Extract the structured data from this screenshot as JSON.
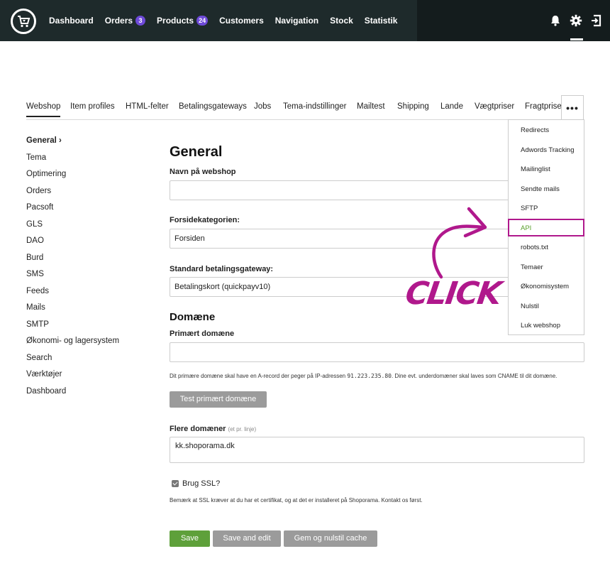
{
  "topnav": {
    "items": [
      {
        "label": "Dashboard"
      },
      {
        "label": "Orders",
        "badge": "3"
      },
      {
        "label": "Products",
        "badge": "24"
      },
      {
        "label": "Customers"
      },
      {
        "label": "Navigation"
      },
      {
        "label": "Stock"
      },
      {
        "label": "Statistik"
      }
    ],
    "icons": [
      "bell-icon",
      "gear-icon",
      "logout-icon"
    ]
  },
  "tabs": [
    {
      "label": "Webshop"
    },
    {
      "label": "Item profiles"
    },
    {
      "label": "HTML-felter"
    },
    {
      "label": "Betalingsgateways"
    },
    {
      "label": "Jobs"
    },
    {
      "label": "Tema-indstillinger"
    },
    {
      "label": "Mailtest"
    },
    {
      "label": "Shipping"
    },
    {
      "label": "Lande"
    },
    {
      "label": "Vægtpriser"
    },
    {
      "label": "Fragtpriser"
    }
  ],
  "more_label": "•••",
  "dropdown": [
    {
      "label": "Redirects"
    },
    {
      "label": "Adwords Tracking"
    },
    {
      "label": "Mailinglist"
    },
    {
      "label": "Sendte mails"
    },
    {
      "label": "SFTP"
    },
    {
      "label": "API"
    },
    {
      "label": "robots.txt"
    },
    {
      "label": "Temaer"
    },
    {
      "label": "Økonomisystem"
    },
    {
      "label": "Nulstil"
    },
    {
      "label": "Luk webshop"
    }
  ],
  "sidebar": [
    {
      "label": "General ›"
    },
    {
      "label": "Tema"
    },
    {
      "label": "Optimering"
    },
    {
      "label": "Orders"
    },
    {
      "label": "Pacsoft"
    },
    {
      "label": "GLS"
    },
    {
      "label": "DAO"
    },
    {
      "label": "Burd"
    },
    {
      "label": "SMS"
    },
    {
      "label": "Feeds"
    },
    {
      "label": "Mails"
    },
    {
      "label": "SMTP"
    },
    {
      "label": "Økonomi- og lagersystem"
    },
    {
      "label": "Search"
    },
    {
      "label": "Værktøjer"
    },
    {
      "label": "Dashboard"
    }
  ],
  "form": {
    "title": "General",
    "shop_name_label": "Navn på webshop",
    "shop_name_value": "",
    "frontpage_label": "Forsidekategorien:",
    "frontpage_value": "Forsiden",
    "gateway_label": "Standard betalingsgateway:",
    "gateway_value": "Betalingskort (quickpayv10)",
    "domain_heading": "Domæne",
    "primary_domain_label": "Primært domæne",
    "primary_domain_value": "",
    "domain_help_pre": "Dit primære domæne skal have en A-record der peger på IP-adressen ",
    "domain_help_ip": "91.223.235.80",
    "domain_help_post": ". Dine evt. underdomæner skal laves som CNAME til dit domæne.",
    "test_domain_button": "Test primært domæne",
    "more_domains_label": "Flere domæner",
    "more_domains_sub": "(et pr. linje)",
    "more_domains_value": "kk.shoporama.dk",
    "ssl_label": "Brug SSL?",
    "ssl_checked": true,
    "ssl_help": "Bemærk at SSL kræver at du har et certifikat, og at det er installeret på Shoporama. Kontakt os først.",
    "save_button": "Save",
    "save_edit_button": "Save and edit",
    "save_cache_button": "Gem og nulstil cache"
  },
  "annotation": {
    "text": "CLICK",
    "color": "#b0188c"
  },
  "colors": {
    "topbar": "#1e2a2b",
    "badge": "#6e4ad8",
    "save": "#5ea03a",
    "grey_button": "#9b9b9b",
    "api_link": "#5aa02c"
  }
}
